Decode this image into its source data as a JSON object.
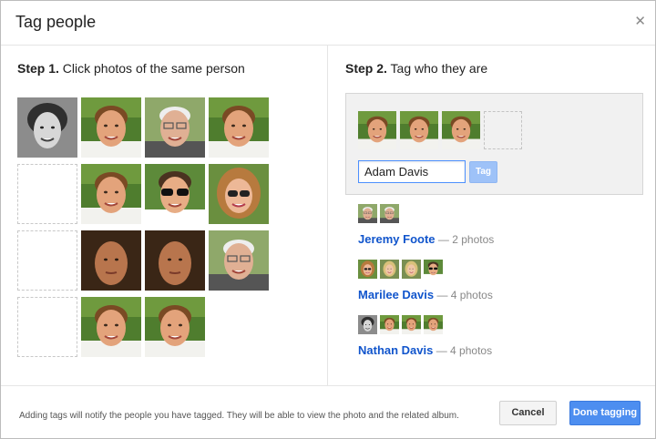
{
  "dialog": {
    "title": "Tag people"
  },
  "step1": {
    "number": "Step 1.",
    "text": "Click photos of the same person"
  },
  "step2": {
    "number": "Step 2.",
    "text": "Tag who they are"
  },
  "tag_form": {
    "input_value": "Adam Davis",
    "tag_button": "Tag"
  },
  "people": [
    {
      "name": "Jeremy Foote",
      "count": "— 2 photos"
    },
    {
      "name": "Marilee Davis",
      "count": "— 4 photos"
    },
    {
      "name": "Nathan Davis",
      "count": "— 4 photos"
    }
  ],
  "footer": {
    "note": "Adding tags will notify the people you have tagged. They will be able to view the photo and the related album.",
    "cancel": "Cancel",
    "done": "Done tagging"
  },
  "colors": {
    "accent": "#4d8ef0",
    "link": "#1155cc",
    "tag_button_disabled": "#9ec2f8"
  }
}
